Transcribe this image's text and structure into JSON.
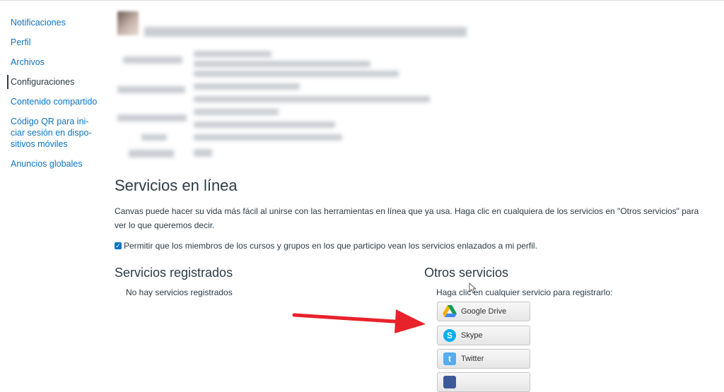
{
  "nav": {
    "items": [
      {
        "label": "Notificaciones"
      },
      {
        "label": "Perfil"
      },
      {
        "label": "Archivos"
      },
      {
        "label": "Configuraciones"
      },
      {
        "label": "Contenido compartido"
      },
      {
        "label": "Código QR para ini-ciar sesión en dispo-sitivos móviles"
      },
      {
        "label": "Anuncios globales"
      }
    ],
    "active_index": 3
  },
  "services": {
    "heading": "Servicios en línea",
    "description": "Canvas puede hacer su vida más fácil al unirse con las herramientas en línea que ya usa. Haga clic en cualquiera de los servicios en \"Otros servicios\" para ver lo que queremos decir.",
    "permission_label": "Permitir que los miembros de los cursos y grupos en los que participo vean los servicios enlazados a mi perfil.",
    "permission_checked": true,
    "registered": {
      "heading": "Servicios registrados",
      "empty_text": "No hay servicios registrados"
    },
    "other": {
      "heading": "Otros servicios",
      "hint": "Haga clic en cualquier servicio para registrarlo:",
      "buttons": [
        {
          "label": "Google Drive",
          "icon": "google-drive-icon"
        },
        {
          "label": "Skype",
          "icon": "skype-icon"
        },
        {
          "label": "Twitter",
          "icon": "twitter-icon"
        },
        {
          "label": "",
          "icon": "facebook-icon"
        }
      ]
    }
  },
  "colors": {
    "link": "#0b74c4",
    "text": "#2d3b45",
    "annotation_arrow": "#e8222b"
  }
}
